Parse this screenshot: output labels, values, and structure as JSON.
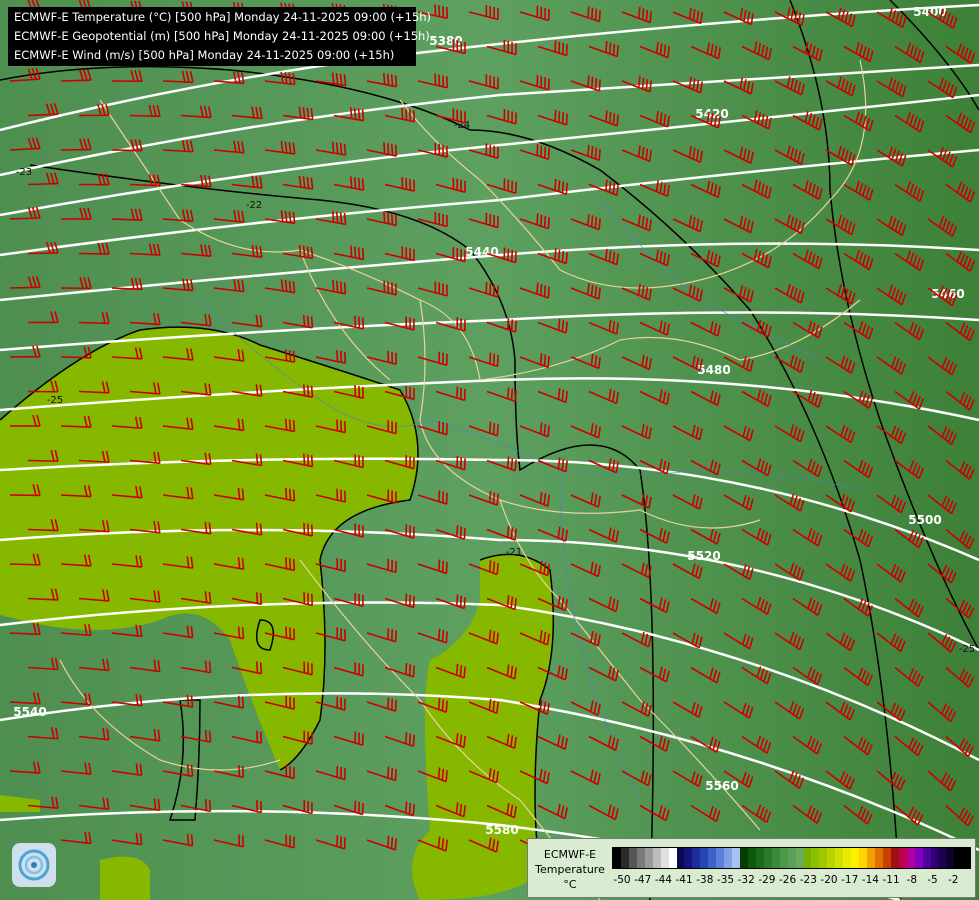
{
  "header": {
    "lines": [
      "ECMWF-E Temperature (°C) [500 hPa] Monday 24-11-2025 09:00 (+15h)",
      "ECMWF-E Geopotential (m) [500 hPa] Monday 24-11-2025 09:00 (+15h)",
      "ECMWF-E Wind (m/s) [500 hPa] Monday 24-11-2025 09:00 (+15h)"
    ]
  },
  "map": {
    "geopotential_labels": [
      "5380",
      "5400",
      "5420",
      "5440",
      "5460",
      "5480",
      "5500",
      "5520",
      "5540",
      "5560",
      "5580"
    ],
    "temperature_labels": [
      "-23",
      "-24",
      "-22",
      "-25",
      "-21",
      "-25"
    ],
    "colors": {
      "background": "#4f8f4f",
      "light_green": "#86b800",
      "isohypse": "#ffffff",
      "isotherm": "#000000",
      "wind_barb": "#cc0000",
      "border": "#e8d49a",
      "river": "#4c7fd8"
    }
  },
  "legend": {
    "title_lines": [
      "ECMWF-E",
      "Temperature",
      "°C"
    ],
    "ticks": [
      "-50",
      "-47",
      "-44",
      "-41",
      "-38",
      "-35",
      "-32",
      "-29",
      "-26",
      "-23",
      "-20",
      "-17",
      "-14",
      "-11",
      "-8",
      "-5",
      "-2"
    ],
    "colors": [
      "#000000",
      "#2a2a2a",
      "#555555",
      "#7a7a7a",
      "#9a9a9a",
      "#bdbdbd",
      "#e0e0e0",
      "#ffffff",
      "#0a0a50",
      "#14147a",
      "#1e2d9b",
      "#2845b4",
      "#3a62c8",
      "#5a80d8",
      "#7fa0e4",
      "#a7c2ef",
      "#063d06",
      "#0c5a0c",
      "#1a6a1a",
      "#2a7a2a",
      "#3a8a3a",
      "#4a9a4a",
      "#5aa05a",
      "#6aaa5a",
      "#78b000",
      "#8ac000",
      "#a0c800",
      "#b8d400",
      "#d0e000",
      "#e8ec00",
      "#fff000",
      "#ffd400",
      "#f0a000",
      "#e07000",
      "#c84000",
      "#a01010",
      "#c00050",
      "#b000a0",
      "#8000c0",
      "#5000a0",
      "#300070",
      "#200050",
      "#100030",
      "#000000",
      "#000000"
    ]
  },
  "logo": {
    "icon": "ecmwf-swirl-icon"
  }
}
